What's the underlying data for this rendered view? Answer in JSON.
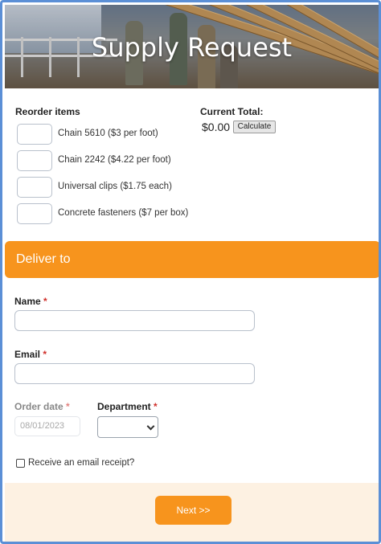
{
  "header": {
    "title": "Supply Request"
  },
  "reorder": {
    "label": "Reorder items",
    "items": [
      {
        "label": "Chain 5610 ($3 per foot)",
        "value": ""
      },
      {
        "label": "Chain 2242 ($4.22 per foot)",
        "value": ""
      },
      {
        "label": "Universal clips ($1.75 each)",
        "value": ""
      },
      {
        "label": "Concrete fasteners ($7 per box)",
        "value": ""
      }
    ]
  },
  "total": {
    "label": "Current Total:",
    "value": "$0.00",
    "calculate_label": "Calculate"
  },
  "deliver": {
    "section_title": "Deliver to",
    "name_label": "Name",
    "email_label": "Email",
    "required_marker": "*",
    "order_date_label": "Order date",
    "order_date_placeholder": "08/01/2023",
    "department_label": "Department",
    "receipt_label": "Receive an email receipt?",
    "receipt_checked": false
  },
  "footer": {
    "next_label": "Next >>"
  },
  "colors": {
    "accent": "#f7941d",
    "frame": "#5b8fd6",
    "required": "#d0302b",
    "footer_bg": "#fdf1e2"
  }
}
